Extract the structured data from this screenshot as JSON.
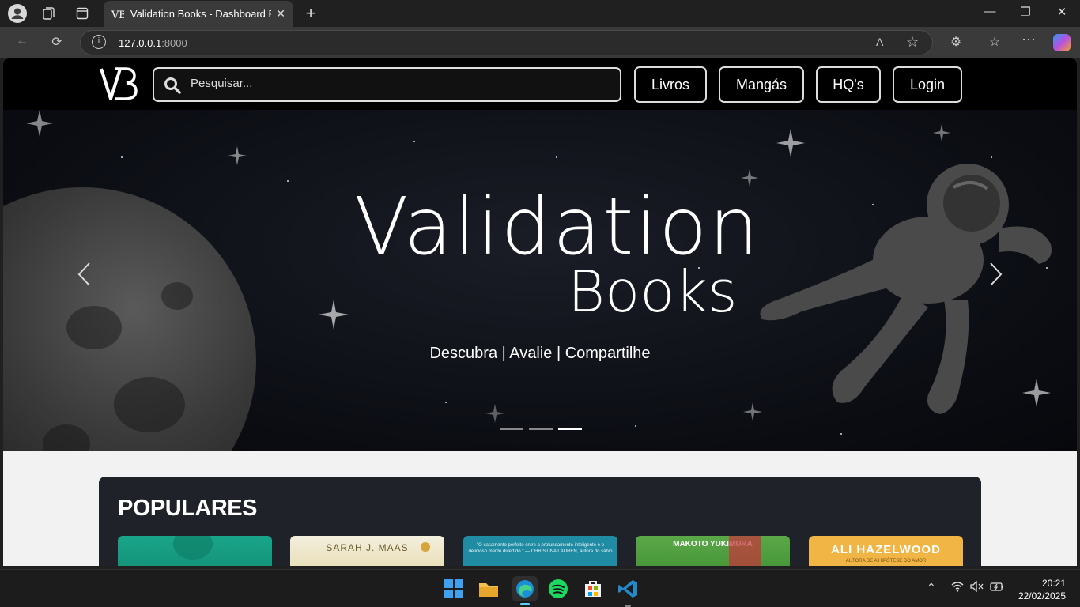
{
  "browser": {
    "tab_title": "Validation Books - Dashboard Page",
    "url_host": "127.0.0.1",
    "url_port": ":8000"
  },
  "navbar": {
    "logo_text": "VB",
    "search_placeholder": "Pesquisar...",
    "buttons": [
      "Livros",
      "Mangás",
      "HQ's",
      "Login"
    ]
  },
  "hero": {
    "title": "Validation",
    "subtitle": "Books",
    "tagline": "Descubra | Avalie | Compartilhe",
    "active_slide": 3,
    "slide_count": 3
  },
  "populares": {
    "title": "POPULARES",
    "covers": [
      {
        "color": "#1aa18a",
        "text": ""
      },
      {
        "color": "#e8e2c8",
        "text": "SARAH J. MAAS"
      },
      {
        "color": "#1f8ca4",
        "text": "\"O casamento perfeito entre a profundamente inteligente e o delicioso mente divertido.\" — CHRISTINA LAUREN, autora do sábio Grelhas Invisíveis"
      },
      {
        "color": "#4aa03a",
        "text": "MAKOTO YUKIMURA"
      },
      {
        "color": "#f0b545",
        "text": "ALI HAZELWOOD",
        "subtext": "AUTORA DE A HIPÓTESE DO AMOR"
      }
    ]
  },
  "taskbar": {
    "time": "20:21",
    "date": "22/02/2025"
  }
}
